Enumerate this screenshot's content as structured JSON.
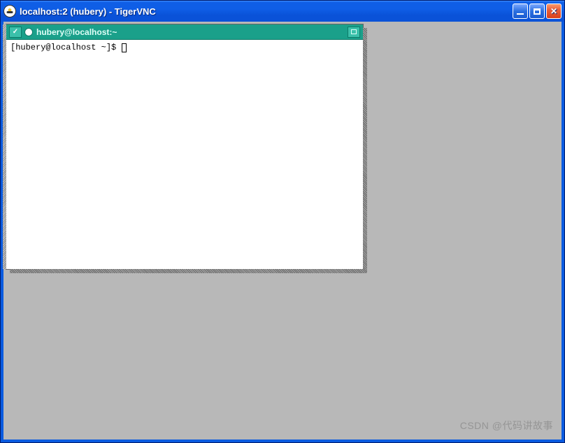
{
  "window": {
    "title": "localhost:2 (hubery) - TigerVNC",
    "buttons": {
      "min": "minimize",
      "max": "maximize",
      "close": "close"
    }
  },
  "terminal": {
    "tab_left": "✓",
    "title": "hubery@localhost:~",
    "prompt": "[hubery@localhost ~]$ "
  },
  "watermark": "CSDN @代码讲故事"
}
